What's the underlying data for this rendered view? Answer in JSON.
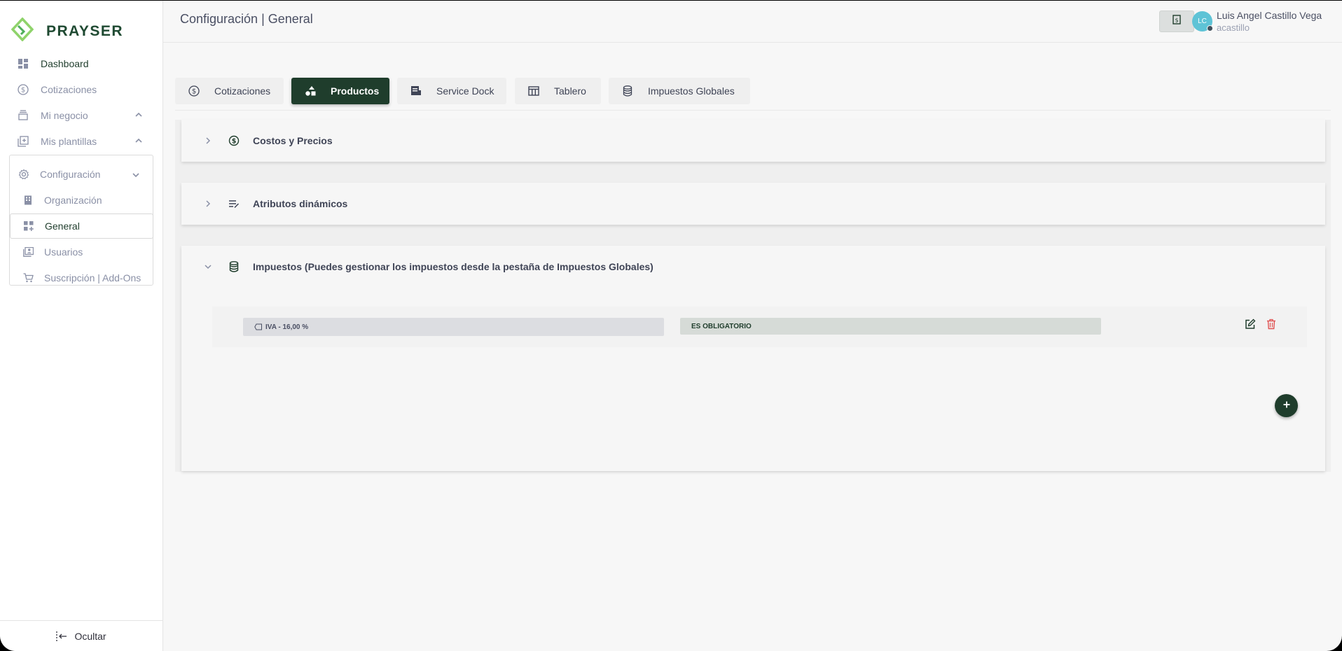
{
  "brand": {
    "name": "PRAYSER",
    "logo_icon": "diamond-logo-icon",
    "accent": "#1f3d2c"
  },
  "sidebar": {
    "items": [
      {
        "label": "Dashboard",
        "icon": "grid-icon"
      },
      {
        "label": "Cotizaciones",
        "icon": "dollar-circle-icon"
      },
      {
        "label": "Mi negocio",
        "icon": "inbox-stack-icon"
      },
      {
        "label": "Mis plantillas",
        "icon": "copy-plus-icon"
      }
    ],
    "config": {
      "label": "Configuración",
      "icon": "gear-icon",
      "children": [
        {
          "label": "Organización",
          "icon": "building-icon"
        },
        {
          "label": "General",
          "icon": "grid-plus-icon"
        },
        {
          "label": "Usuarios",
          "icon": "user-card-icon"
        },
        {
          "label": "Suscripción | Add-Ons",
          "icon": "cart-icon"
        }
      ]
    },
    "footer_label": "Ocultar"
  },
  "header": {
    "title": "Configuración | General",
    "user": {
      "initials": "LC",
      "name": "Luis Angel Castillo Vega",
      "login": "acastillo"
    }
  },
  "tabs": [
    {
      "label": "Cotizaciones",
      "icon": "dollar-circle-icon"
    },
    {
      "label": "Productos",
      "icon": "shapes-icon"
    },
    {
      "label": "Service Dock",
      "icon": "receipt-icon"
    },
    {
      "label": "Tablero",
      "icon": "table-icon"
    },
    {
      "label": "Impuestos Globales",
      "icon": "database-icon"
    }
  ],
  "sections": [
    {
      "title": "Costos y Precios",
      "icon": "dollar-circle-icon",
      "expanded": false
    },
    {
      "title": "Atributos dinámicos",
      "icon": "list-edit-icon",
      "expanded": false
    },
    {
      "title": "Impuestos (Puedes gestionar los impuestos desde la pestaña de Impuestos Globales)",
      "icon": "database-icon",
      "expanded": true
    }
  ],
  "taxes": [
    {
      "name": "IVA - 16,00 %",
      "requirement": "ES OBLIGATORIO"
    }
  ],
  "colors": {
    "delete": "#e05252",
    "edit": "#1f3d2c",
    "avatar": "#5ec3d6"
  }
}
